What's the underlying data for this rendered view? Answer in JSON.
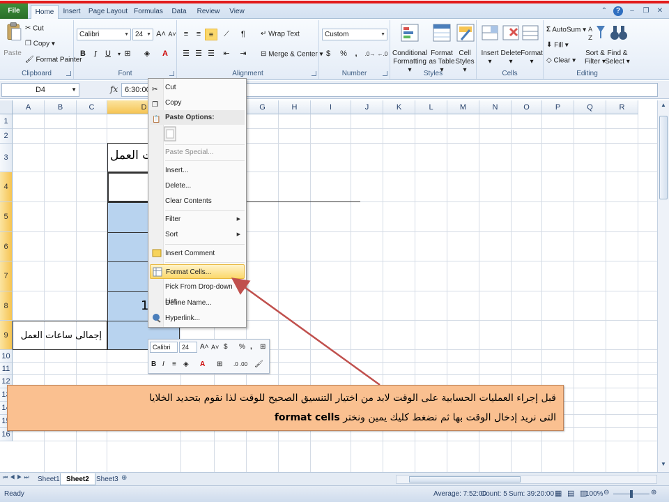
{
  "tabs": [
    {
      "label": "File"
    },
    {
      "label": "Home"
    },
    {
      "label": "Insert"
    },
    {
      "label": "Page Layout"
    },
    {
      "label": "Formulas"
    },
    {
      "label": "Data"
    },
    {
      "label": "Review"
    },
    {
      "label": "View"
    }
  ],
  "ribbon": {
    "clipboard": {
      "label": "Clipboard",
      "paste": "Paste",
      "cut": "Cut",
      "copy": "Copy",
      "format_painter": "Format Painter"
    },
    "font": {
      "label": "Font",
      "name": "Calibri",
      "size": "24",
      "bold": "B",
      "italic": "I",
      "underline": "U"
    },
    "alignment": {
      "label": "Alignment",
      "wrap_text": "Wrap Text",
      "merge_center": "Merge & Center"
    },
    "number": {
      "label": "Number",
      "format": "Custom",
      "percent": "%",
      "comma": ","
    },
    "styles": {
      "label": "Styles",
      "conditional": "Conditional",
      "formatting": "Formatting",
      "format": "Format",
      "as_table": "as Table",
      "cell": "Cell",
      "styles_btn": "Styles"
    },
    "cells": {
      "label": "Cells",
      "insert": "Insert",
      "delete": "Delete",
      "format": "Format"
    },
    "editing": {
      "label": "Editing",
      "autosum": "AutoSum",
      "fill": "Fill",
      "clear": "Clear",
      "sort": "Sort &",
      "filter": "Filter",
      "find": "Find &",
      "select": "Select"
    }
  },
  "formula_bar": {
    "name_box": "D4",
    "fx": "fx",
    "value": "6:30:00"
  },
  "columns": [
    "A",
    "B",
    "C",
    "D",
    "E",
    "F",
    "G",
    "H",
    "I",
    "J",
    "K",
    "L",
    "M",
    "N",
    "O",
    "P",
    "Q",
    "R"
  ],
  "rows": [
    "1",
    "2",
    "3",
    "4",
    "5",
    "6",
    "7",
    "8",
    "9",
    "10",
    "11",
    "12",
    "13",
    "14",
    "15",
    "16"
  ],
  "cells": {
    "d3_header": "ساعات العمل",
    "d8_partial": "1",
    "a9_total": "إجمالى ساعات العمل"
  },
  "context_menu": {
    "cut": "Cut",
    "copy": "Copy",
    "paste_options": "Paste Options:",
    "paste_special": "Paste Special...",
    "insert": "Insert...",
    "delete": "Delete...",
    "clear_contents": "Clear Contents",
    "filter": "Filter",
    "sort": "Sort",
    "insert_comment": "Insert Comment",
    "format_cells": "Format Cells...",
    "pick_list": "Pick From Drop-down List...",
    "define_name": "Define Name...",
    "hyperlink": "Hyperlink..."
  },
  "mini_toolbar": {
    "font": "Calibri",
    "size": "24",
    "currency": "$",
    "percent": "%",
    "comma": ","
  },
  "sheets": [
    {
      "label": "Sheet1"
    },
    {
      "label": "Sheet2"
    },
    {
      "label": "Sheet3"
    }
  ],
  "status": {
    "ready": "Ready",
    "average": "Average: 7:52:00",
    "count": "Count: 5",
    "sum": "Sum: 39:20:00",
    "zoom": "100%"
  },
  "annotation": {
    "line1": "قبل إجراء العمليات الحسابية على الوقت لابد من اختيار التنسيق الصحيح للوقت لذا نقوم بتحديد الخلايا",
    "line2_prefix": "التى نريد إدخال الوقت بها ثم نضغط كليك يمين ونختر",
    "line2_bold": "format cells"
  },
  "colors": {
    "accent": "#f6c452",
    "file_tab": "#2a6f28",
    "selection": "#b8d3ef",
    "callout": "#fac090",
    "arrow": "#c0504d"
  }
}
